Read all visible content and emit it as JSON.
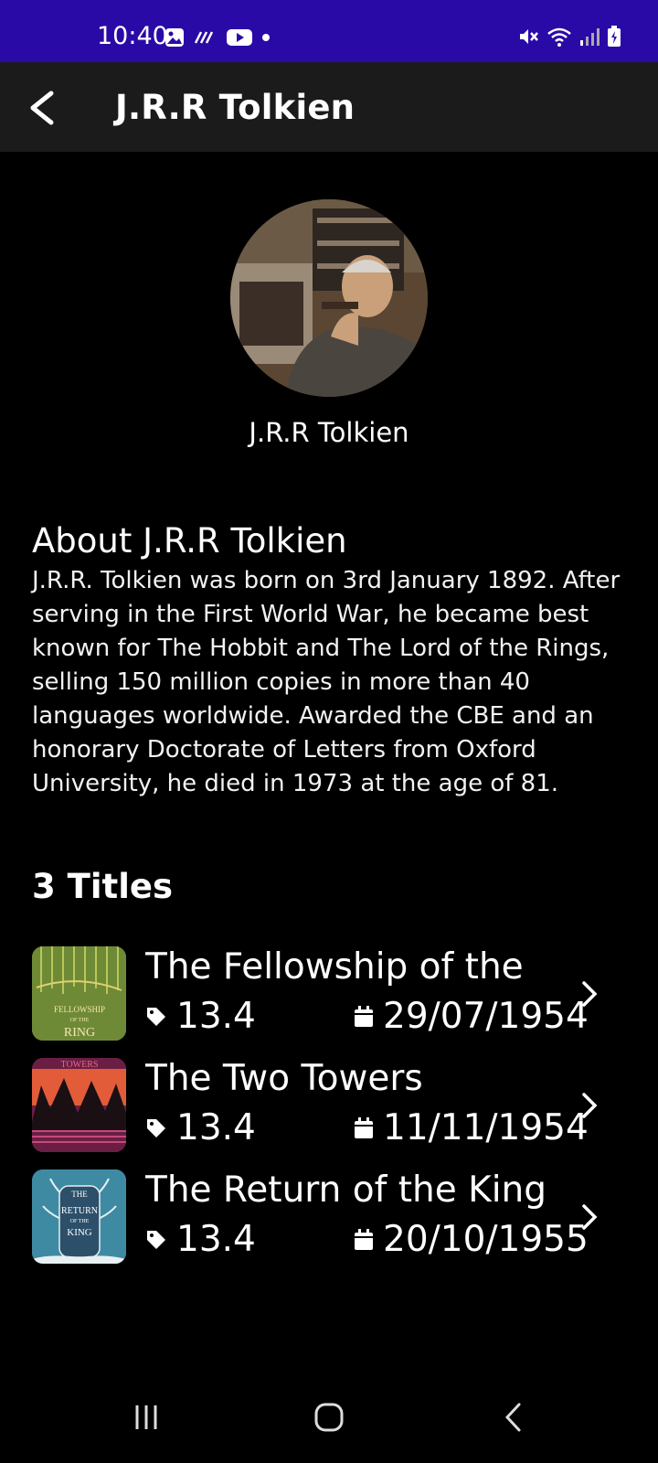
{
  "status_bar": {
    "time": "10:40",
    "bg_color": "#2a0aa6",
    "left_icons": [
      "image-icon",
      "missed-call-icon",
      "youtube-icon",
      "dot-icon"
    ],
    "right_icons": [
      "mute-icon",
      "wifi-icon",
      "signal-icon",
      "battery-charging-icon"
    ]
  },
  "app_bar": {
    "title": "J.R.R Tolkien",
    "back_icon": "arrow-back-icon"
  },
  "author": {
    "name": "J.R.R Tolkien"
  },
  "about": {
    "heading": "About J.R.R Tolkien",
    "body": "J.R.R. Tolkien was born on 3rd January 1892. After serving in the First World War, he became best known for The Hobbit and The Lord of the Rings, selling 150 million copies in more than 40 languages worldwide. Awarded the CBE and an honorary Doctorate of Letters from Oxford University, he died in 1973 at the age of 81."
  },
  "titles": {
    "heading": "3 Titles",
    "items": [
      {
        "title": "The Fellowship of the",
        "price": "13.4",
        "date": "29/07/1954",
        "cover_color": "#6f8a36",
        "cover_lines": [
          "FELLOWSHIP",
          "OF THE",
          "RING"
        ]
      },
      {
        "title": "The Two Towers",
        "price": "13.4",
        "date": "11/11/1954",
        "cover_color": "#6b1e44",
        "cover_lines": [
          "TOWERS"
        ]
      },
      {
        "title": "The Return of the King",
        "price": "13.4",
        "date": "20/10/1955",
        "cover_color": "#3f8aa3",
        "cover_lines": [
          "THE",
          "RETURN",
          "OF THE",
          "KING"
        ]
      }
    ]
  },
  "nav_bar": {
    "buttons": [
      "recents-icon",
      "home-icon",
      "back-icon"
    ]
  }
}
